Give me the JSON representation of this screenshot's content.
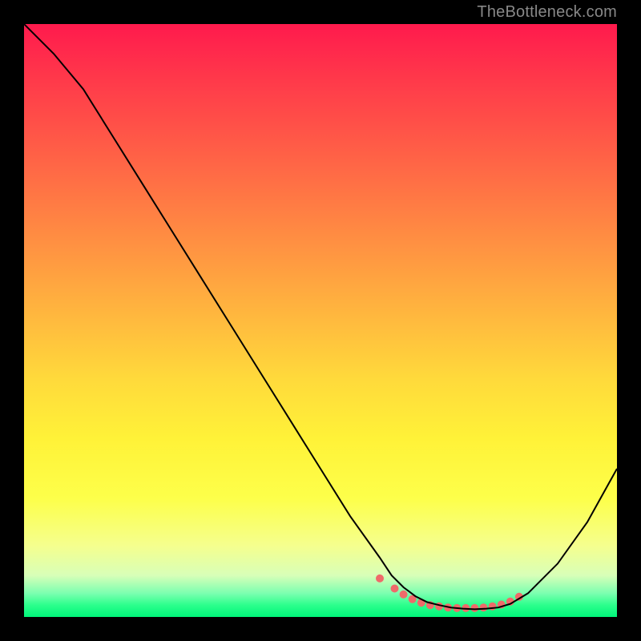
{
  "watermark": "TheBottleneck.com",
  "chart_data": {
    "type": "line",
    "title": "",
    "xlabel": "",
    "ylabel": "",
    "xlim": [
      0,
      100
    ],
    "ylim": [
      0,
      100
    ],
    "series": [
      {
        "name": "bottleneck-curve",
        "color": "#000000",
        "stroke_width": 2,
        "x": [
          0,
          5,
          10,
          15,
          20,
          25,
          30,
          35,
          40,
          45,
          50,
          55,
          60,
          62,
          64,
          66,
          68,
          70,
          72,
          74,
          76,
          78,
          80,
          82,
          85,
          90,
          95,
          100
        ],
        "y": [
          100,
          95,
          89,
          81,
          73,
          65,
          57,
          49,
          41,
          33,
          25,
          17,
          10,
          7,
          5,
          3.5,
          2.5,
          2,
          1.6,
          1.4,
          1.3,
          1.4,
          1.6,
          2.2,
          4,
          9,
          16,
          25
        ]
      },
      {
        "name": "optimal-band-dots",
        "color": "#ef6a6a",
        "marker": "dot",
        "marker_size": 10,
        "x": [
          60,
          62.5,
          64,
          65.5,
          67,
          68.5,
          70,
          71.5,
          73,
          74.5,
          76,
          77.5,
          79,
          80.5,
          82,
          83.5
        ],
        "y": [
          6.5,
          4.8,
          3.8,
          3.0,
          2.4,
          2.0,
          1.8,
          1.6,
          1.5,
          1.5,
          1.5,
          1.6,
          1.8,
          2.1,
          2.6,
          3.4
        ]
      }
    ],
    "background_gradient": {
      "direction": "top-to-bottom",
      "stops": [
        {
          "pos": 0,
          "color": "#ff1a4d"
        },
        {
          "pos": 10,
          "color": "#ff3b4a"
        },
        {
          "pos": 20,
          "color": "#ff5a47"
        },
        {
          "pos": 30,
          "color": "#ff7a44"
        },
        {
          "pos": 40,
          "color": "#ff9a41"
        },
        {
          "pos": 50,
          "color": "#ffba3e"
        },
        {
          "pos": 60,
          "color": "#ffda3b"
        },
        {
          "pos": 70,
          "color": "#fff238"
        },
        {
          "pos": 80,
          "color": "#fdff4a"
        },
        {
          "pos": 88,
          "color": "#f5ff8e"
        },
        {
          "pos": 93,
          "color": "#d8ffb8"
        },
        {
          "pos": 96,
          "color": "#7cffb0"
        },
        {
          "pos": 98,
          "color": "#2cff8c"
        },
        {
          "pos": 100,
          "color": "#00f57a"
        }
      ]
    }
  }
}
